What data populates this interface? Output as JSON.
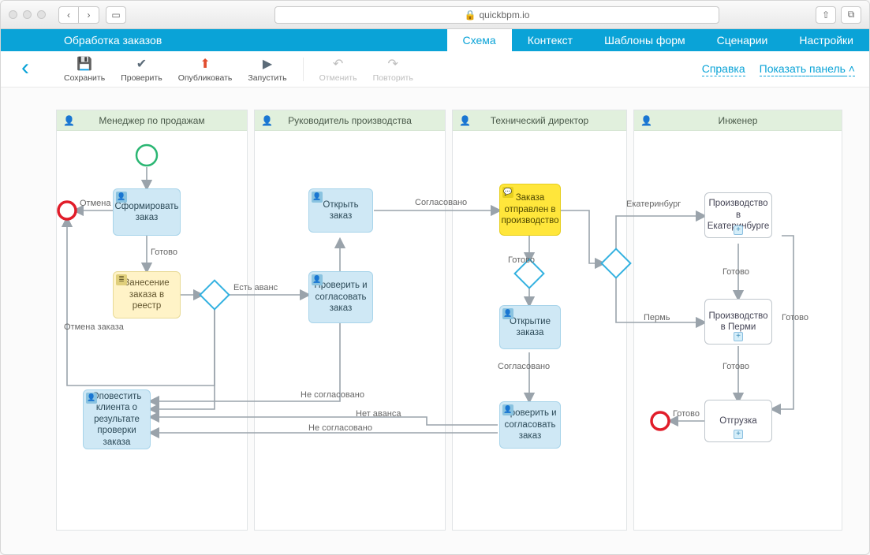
{
  "url": "quickbpm.io",
  "blue": {
    "title": "Обработка заказов",
    "tabs": [
      "Схема",
      "Контекст",
      "Шаблоны форм",
      "Сценарии",
      "Настройки"
    ],
    "active": 0
  },
  "toolbar": {
    "save": "Сохранить",
    "check": "Проверить",
    "publish": "Опубликовать",
    "run": "Запустить",
    "undo": "Отменить",
    "redo": "Повторить",
    "help": "Справка",
    "panel": "Показать панель"
  },
  "lanes": [
    {
      "title": "Менеджер по продажам"
    },
    {
      "title": "Руководитель производства"
    },
    {
      "title": "Технический директор"
    },
    {
      "title": "Инженер"
    }
  ],
  "nodes": {
    "form_order": "Сформировать заказ",
    "cancel": "Отмена",
    "ready": "Готово",
    "register": "Занесение заказа в реестр",
    "advance": "Есть аванс",
    "cancel_order": "Отмена заказа",
    "notify": "Оповестить клиента о результате проверки заказа",
    "open_order": "Открыть заказ",
    "check_coord": "Проверить и согласовать заказ",
    "agreed": "Согласовано",
    "no_advance": "Нет аванса",
    "not_agreed": "Не согласовано",
    "sent_prod": "Заказа отправлен в производство",
    "open_order2": "Открытие заказа",
    "check_coord2": "Проверить и согласовать заказ",
    "ekb": "Екатеринбург",
    "perm": "Пермь",
    "prod_ekb": "Производство в Екатеринбурге",
    "prod_perm": "Производство в Перми",
    "ship": "Отгрузка"
  }
}
